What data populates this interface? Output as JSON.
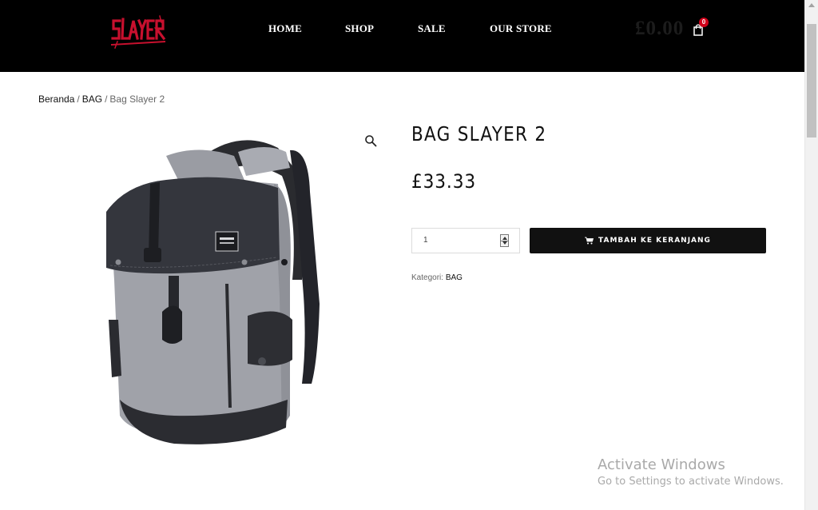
{
  "header": {
    "logo_text": "SLAYER",
    "nav": [
      {
        "label": "HOME"
      },
      {
        "label": "SHOP"
      },
      {
        "label": "SALE"
      },
      {
        "label": "OUR STORE"
      }
    ],
    "cart_total": "£0.00",
    "cart_count": "0",
    "brand_red": "#c8102e",
    "badge_red": "#d0021b"
  },
  "breadcrumb": {
    "items": [
      "Beranda",
      "BAG",
      "Bag Slayer 2"
    ],
    "separator": "/"
  },
  "product": {
    "title": "BAG SLAYER 2",
    "price": "£33.33",
    "quantity": "1",
    "add_to_cart_label": "TAMBAH KE KERANJANG",
    "category_label": "Kategori:",
    "category_value": "BAG",
    "image_icon": "backpack-image",
    "zoom_icon": "magnifier-icon"
  },
  "watermark": {
    "title": "Activate Windows",
    "subtitle": "Go to Settings to activate Windows."
  }
}
